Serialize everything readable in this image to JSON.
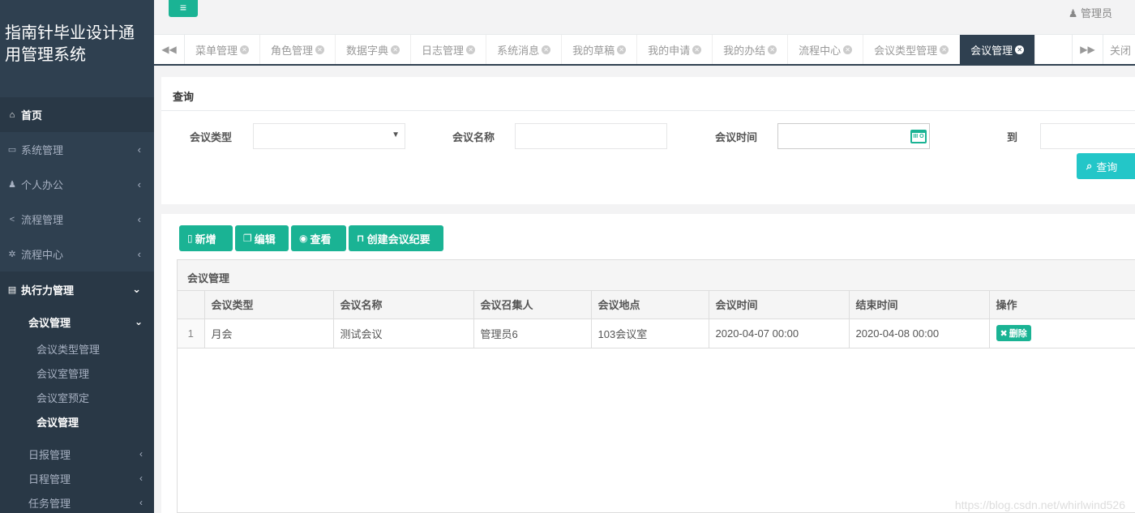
{
  "app": {
    "title": "指南针毕业设计通用管理系统"
  },
  "topbar": {
    "menu_icon": "≡",
    "user": "管理员"
  },
  "sidebar": {
    "home": "首页",
    "items": [
      {
        "label": "系统管理",
        "icon": "monitor-icon"
      },
      {
        "label": "个人办公",
        "icon": "user-icon"
      },
      {
        "label": "流程管理",
        "icon": "share-icon"
      },
      {
        "label": "流程中心",
        "icon": "gear-icon"
      }
    ],
    "open_section": "执行力管理",
    "open_sub": "会议管理",
    "subsub": [
      "会议类型管理",
      "会议室管理",
      "会议室预定",
      "会议管理"
    ],
    "other_subs": [
      "日报管理",
      "日程管理",
      "任务管理"
    ]
  },
  "tabs": {
    "items": [
      "菜单管理",
      "角色管理",
      "数据字典",
      "日志管理",
      "系统消息",
      "我的草稿",
      "我的申请",
      "我的办结",
      "流程中心",
      "会议类型管理",
      "会议管理"
    ],
    "active": "会议管理",
    "close_label": "关闭"
  },
  "query": {
    "title": "查询",
    "type_label": "会议类型",
    "name_label": "会议名称",
    "time_label": "会议时间",
    "to_label": "到",
    "calendar_text": "III O",
    "button": "查询"
  },
  "toolbar": {
    "add": "新增",
    "edit": "编辑",
    "view": "查看",
    "minutes": "创建会议纪要"
  },
  "grid": {
    "caption": "会议管理",
    "columns": [
      "会议类型",
      "会议名称",
      "会议召集人",
      "会议地点",
      "会议时间",
      "结束时间",
      "操作"
    ],
    "rows": [
      {
        "n": "1",
        "type": "月会",
        "name": "测试会议",
        "host": "管理员6",
        "place": "103会议室",
        "start": "2020-04-07 00:00",
        "end": "2020-04-08 00:00",
        "action": "删除"
      }
    ]
  },
  "watermark": "https://blog.csdn.net/whirlwind526",
  "colors": {
    "accent": "#1ab394",
    "info": "#23c6c8",
    "sidebar": "#2f4050"
  }
}
